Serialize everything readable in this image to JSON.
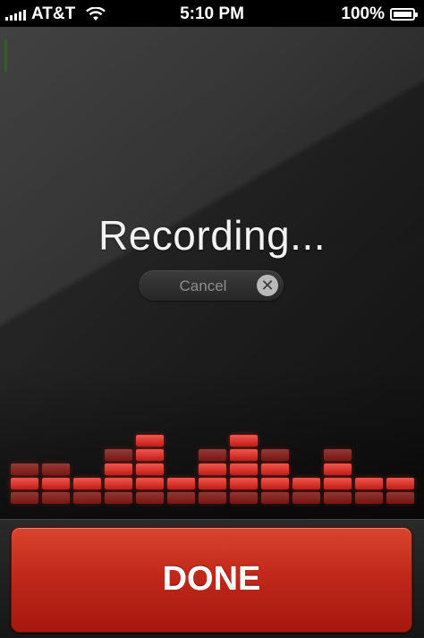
{
  "status_bar": {
    "carrier": "AT&T",
    "time": "5:10 PM",
    "battery_percent": "100%",
    "battery_level": 1.0,
    "signal_bars": 5
  },
  "recording": {
    "title": "Recording...",
    "cancel_label": "Cancel",
    "cancel_icon": "close-icon",
    "equalizer_levels": [
      3,
      3,
      2,
      4,
      5,
      2,
      4,
      5,
      4,
      2,
      4,
      2,
      2
    ],
    "equalizer_max_levels": 5
  },
  "done_button": {
    "label": "DONE"
  },
  "colors": {
    "accent_red": "#c1281a",
    "eq_red": "#e8312a",
    "background": "#303030"
  }
}
